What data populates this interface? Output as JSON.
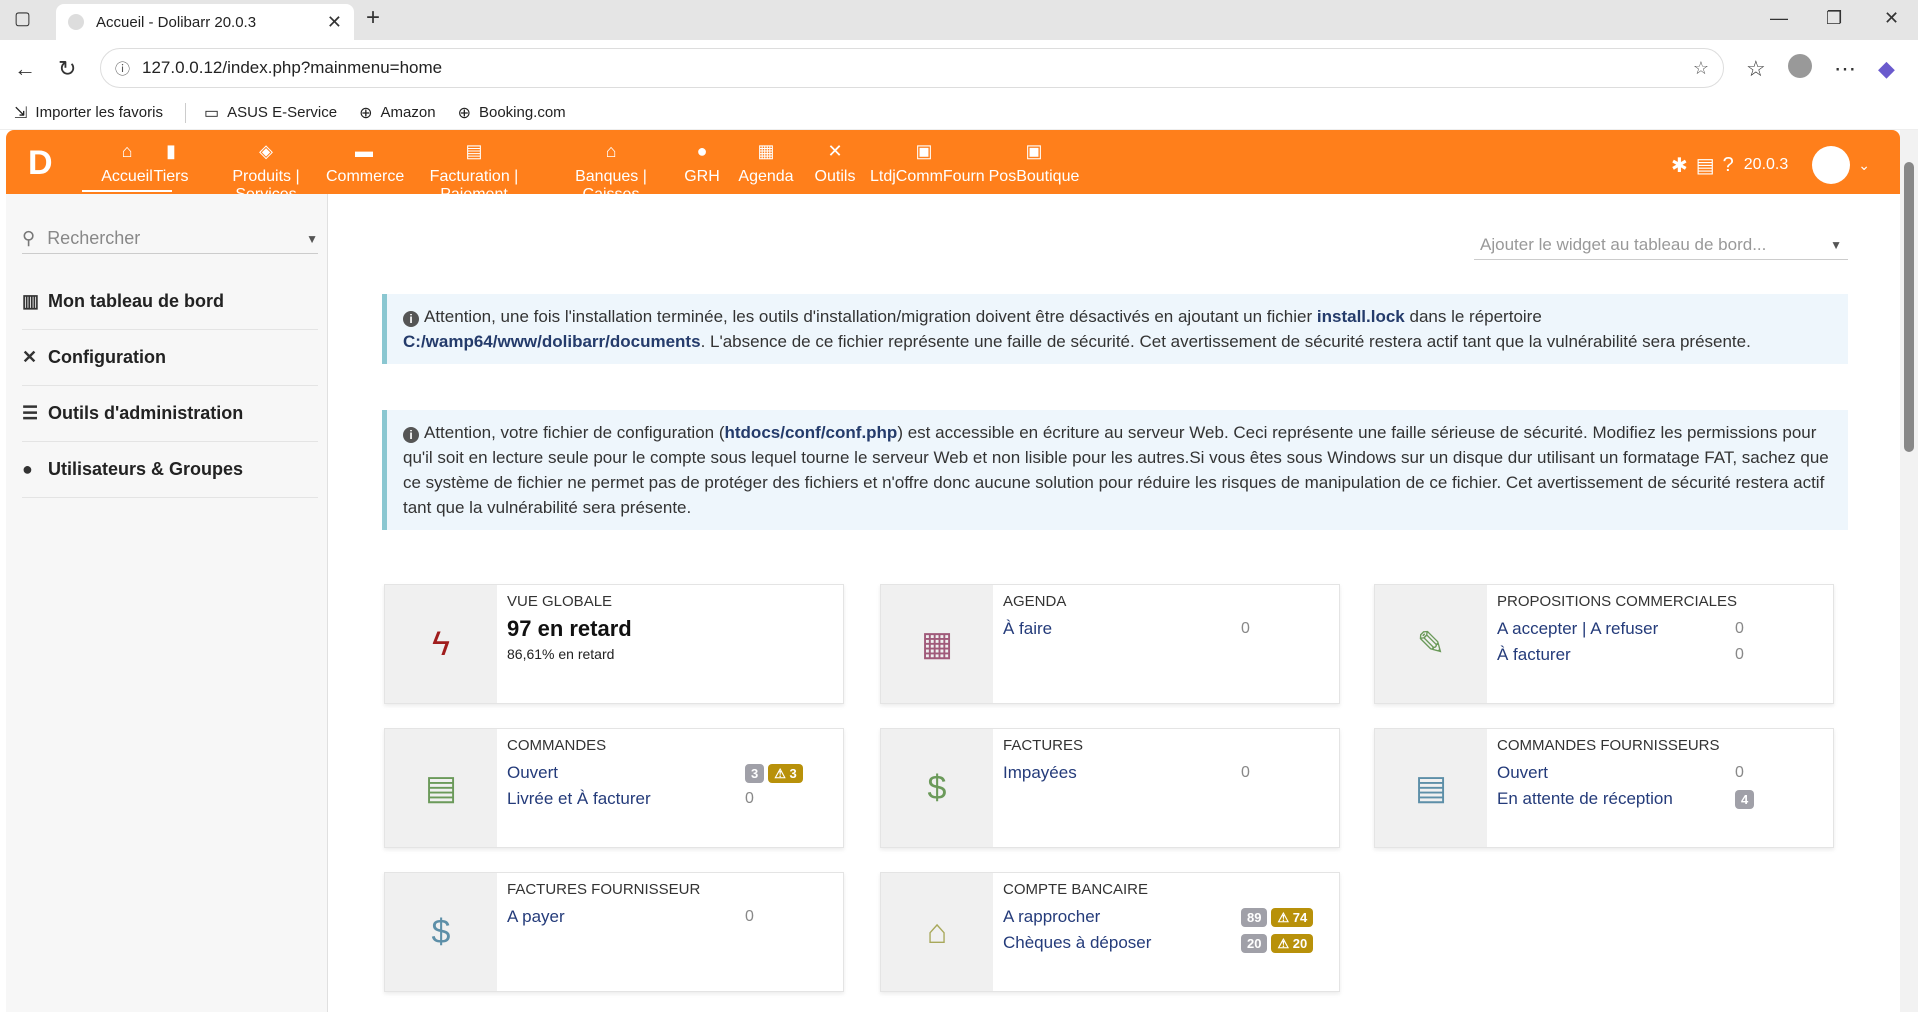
{
  "browser": {
    "tab_title": "Accueil - Dolibarr 20.0.3",
    "url": "127.0.0.12/index.php?mainmenu=home",
    "bookmarks": [
      "Importer les favoris",
      "ASUS E-Service",
      "Amazon",
      "Booking.com"
    ]
  },
  "topmenu": {
    "items": [
      {
        "label": "Accueil",
        "icon": "home-icon"
      },
      {
        "label": "Tiers",
        "icon": "building-icon"
      },
      {
        "label": "Produits | Services",
        "icon": "cube-icon"
      },
      {
        "label": "Commerce",
        "icon": "briefcase-icon"
      },
      {
        "label": "Facturation | Paiement",
        "icon": "invoice-icon"
      },
      {
        "label": "Banques | Caisses",
        "icon": "bank-icon"
      },
      {
        "label": "GRH",
        "icon": "user-tie-icon"
      },
      {
        "label": "Agenda",
        "icon": "calendar-icon"
      },
      {
        "label": "Outils",
        "icon": "tools-icon"
      },
      {
        "label": "LtdjCommFourn",
        "icon": "cash-register-icon"
      },
      {
        "label": "PosBoutique",
        "icon": "cash-register-icon"
      }
    ],
    "version": "20.0.3"
  },
  "leftmenu": {
    "search_placeholder": "Rechercher",
    "items": [
      {
        "label": "Mon tableau de bord",
        "icon": "chart-icon"
      },
      {
        "label": "Configuration",
        "icon": "tools-icon"
      },
      {
        "label": "Outils d'administration",
        "icon": "server-icon"
      },
      {
        "label": "Utilisateurs & Groupes",
        "icon": "user-icon"
      }
    ]
  },
  "main": {
    "widget_placeholder": "Ajouter le widget au tableau de bord...",
    "warning1": {
      "t1": "Attention, une fois l'installation terminée, les outils d'installation/migration doivent être désactivés en ajoutant un fichier ",
      "b1": "install.lock",
      "t2": " dans le répertoire ",
      "b2": "C:/wamp64/www/dolibarr/documents",
      "t3": ". L'absence de ce fichier représente une faille de sécurité. Cet avertissement de sécurité restera actif tant que la vulnérabilité sera présente."
    },
    "warning2": {
      "t1": "Attention, votre fichier de configuration (",
      "b1": "htdocs/conf/conf.php",
      "t2": ") est accessible en écriture au serveur Web. Ceci représente une faille sérieuse de sécurité. Modifiez les permissions pour qu'il soit en lecture seule pour le compte sous lequel tourne le serveur Web et non lisible pour les autres.Si vous êtes sous Windows sur un disque dur utilisant un formatage FAT, sachez que ce système de fichier ne permet pas de protéger des fichiers et n'offre donc aucune solution pour réduire les risques de manipulation de ce fichier. Cet avertissement de sécurité restera actif tant que la vulnérabilité sera présente."
    },
    "boxes": {
      "vue_globale": {
        "title": "VUE GLOBALE",
        "big": "97 en retard",
        "small": "86,61% en retard"
      },
      "agenda": {
        "title": "AGENDA",
        "rows": [
          {
            "label": "À faire",
            "value": "0"
          }
        ]
      },
      "propositions": {
        "title": "PROPOSITIONS COMMERCIALES",
        "rows": [
          {
            "label": "A accepter | A refuser",
            "value": "0"
          },
          {
            "label": "À facturer",
            "value": "0"
          }
        ]
      },
      "commandes": {
        "title": "COMMANDES",
        "rows": [
          {
            "label": "Ouvert",
            "badge1": "3",
            "badge2": "3"
          },
          {
            "label": "Livrée et À facturer",
            "value": "0"
          }
        ]
      },
      "factures": {
        "title": "FACTURES",
        "rows": [
          {
            "label": "Impayées",
            "value": "0"
          }
        ]
      },
      "commandes_fourn": {
        "title": "COMMANDES FOURNISSEURS",
        "rows": [
          {
            "label": "Ouvert",
            "value": "0"
          },
          {
            "label": "En attente de réception",
            "badge1": "4"
          }
        ]
      },
      "factures_fourn": {
        "title": "FACTURES FOURNISSEUR",
        "rows": [
          {
            "label": "A payer",
            "value": "0"
          }
        ]
      },
      "compte_bancaire": {
        "title": "COMPTE BANCAIRE",
        "rows": [
          {
            "label": "A rapprocher",
            "badge1": "89",
            "badge2": "74"
          },
          {
            "label": "Chèques à déposer",
            "badge1": "20",
            "badge2": "20"
          }
        ]
      }
    }
  },
  "colors": {
    "brand": "#ff7f1b",
    "link": "#243b7a",
    "info_border": "#8ac7d1"
  }
}
